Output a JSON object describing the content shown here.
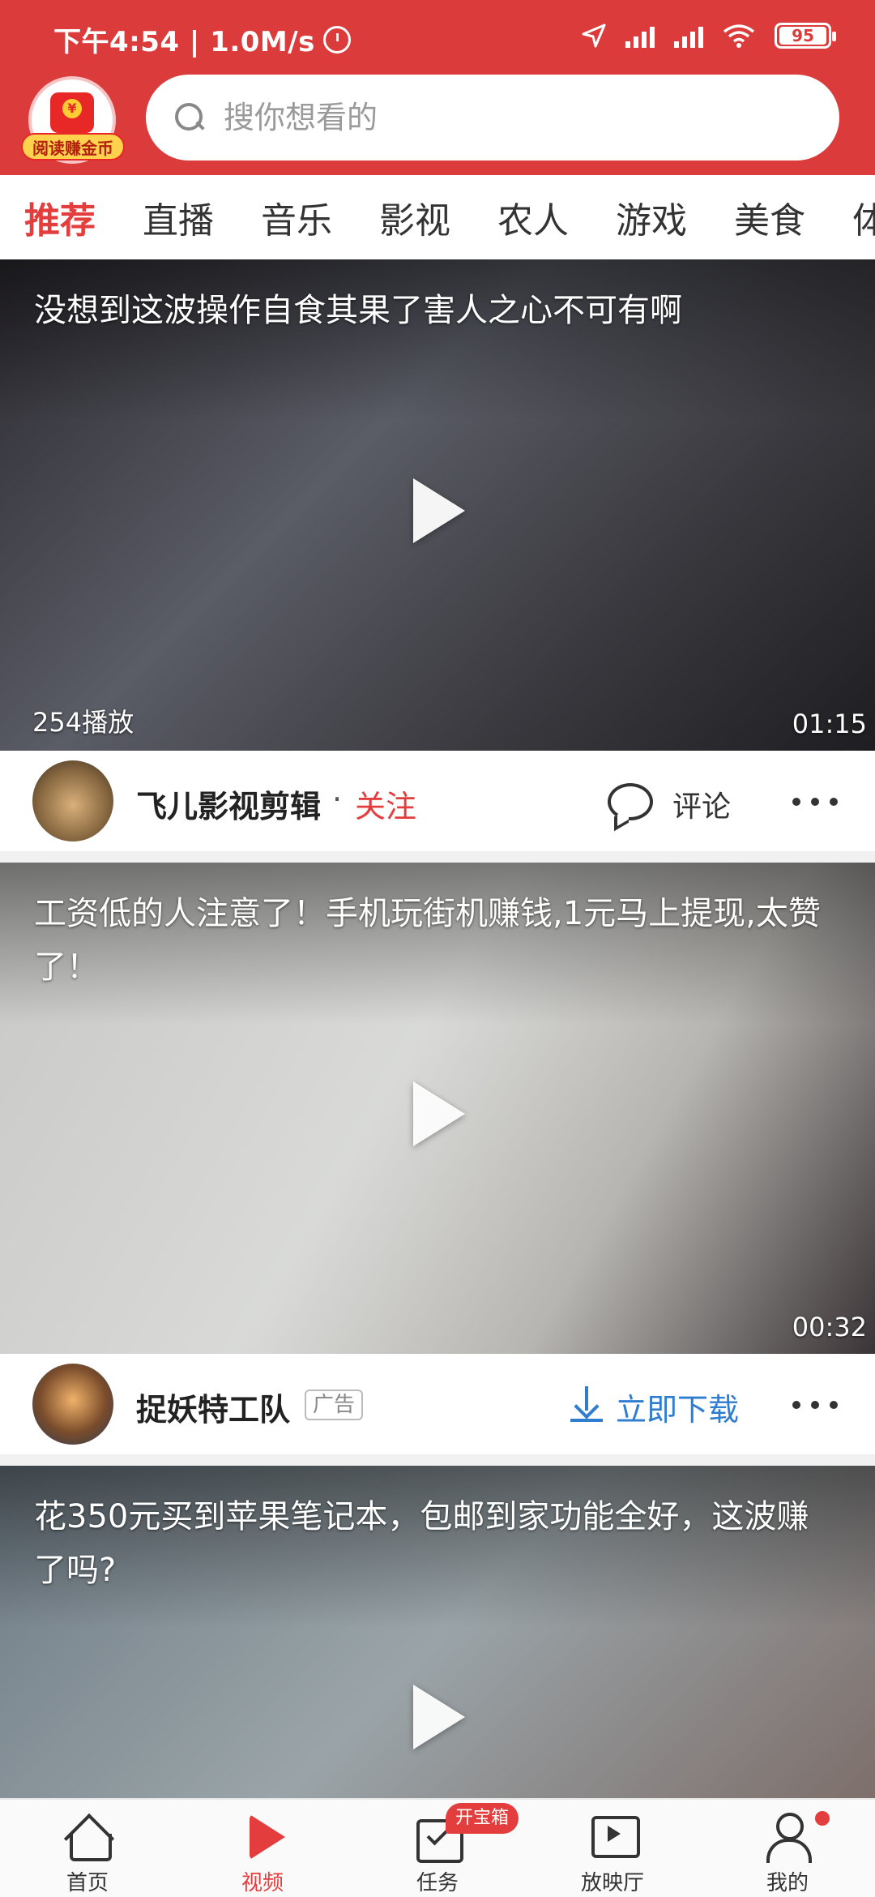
{
  "status_bar": {
    "time_speed": "下午4:54 | 1.0M/s",
    "battery": "95"
  },
  "header": {
    "coin_label": "阅读赚金币",
    "search_placeholder": "搜你想看的"
  },
  "tabs": [
    "推荐",
    "直播",
    "音乐",
    "影视",
    "农人",
    "游戏",
    "美食",
    "体"
  ],
  "feed": [
    {
      "title": "没想到这波操作自食其果了害人之心不可有啊",
      "play_count": "254播放",
      "duration": "01:15",
      "author": "飞儿影视剪辑",
      "separator": "·",
      "follow": "关注",
      "comment": "评论"
    },
    {
      "title": "工资低的人注意了！手机玩街机赚钱,1元马上提现,太赞了！",
      "duration": "00:32",
      "author": "捉妖特工队",
      "ad_tag": "广告",
      "download": "立即下载"
    },
    {
      "title": "花350元买到苹果笔记本，包邮到家功能全好，这波赚了吗?"
    }
  ],
  "bottom_nav": [
    {
      "label": "首页",
      "icon": "home-icon"
    },
    {
      "label": "视频",
      "icon": "video-play-icon",
      "active": true
    },
    {
      "label": "任务",
      "icon": "task-icon",
      "badge": "开宝箱"
    },
    {
      "label": "放映厅",
      "icon": "theater-icon"
    },
    {
      "label": "我的",
      "icon": "profile-icon"
    }
  ],
  "colors": {
    "header_bg": "#dc3b3b",
    "accent_red": "#e33d3d",
    "download_blue": "#2f7dd1"
  }
}
